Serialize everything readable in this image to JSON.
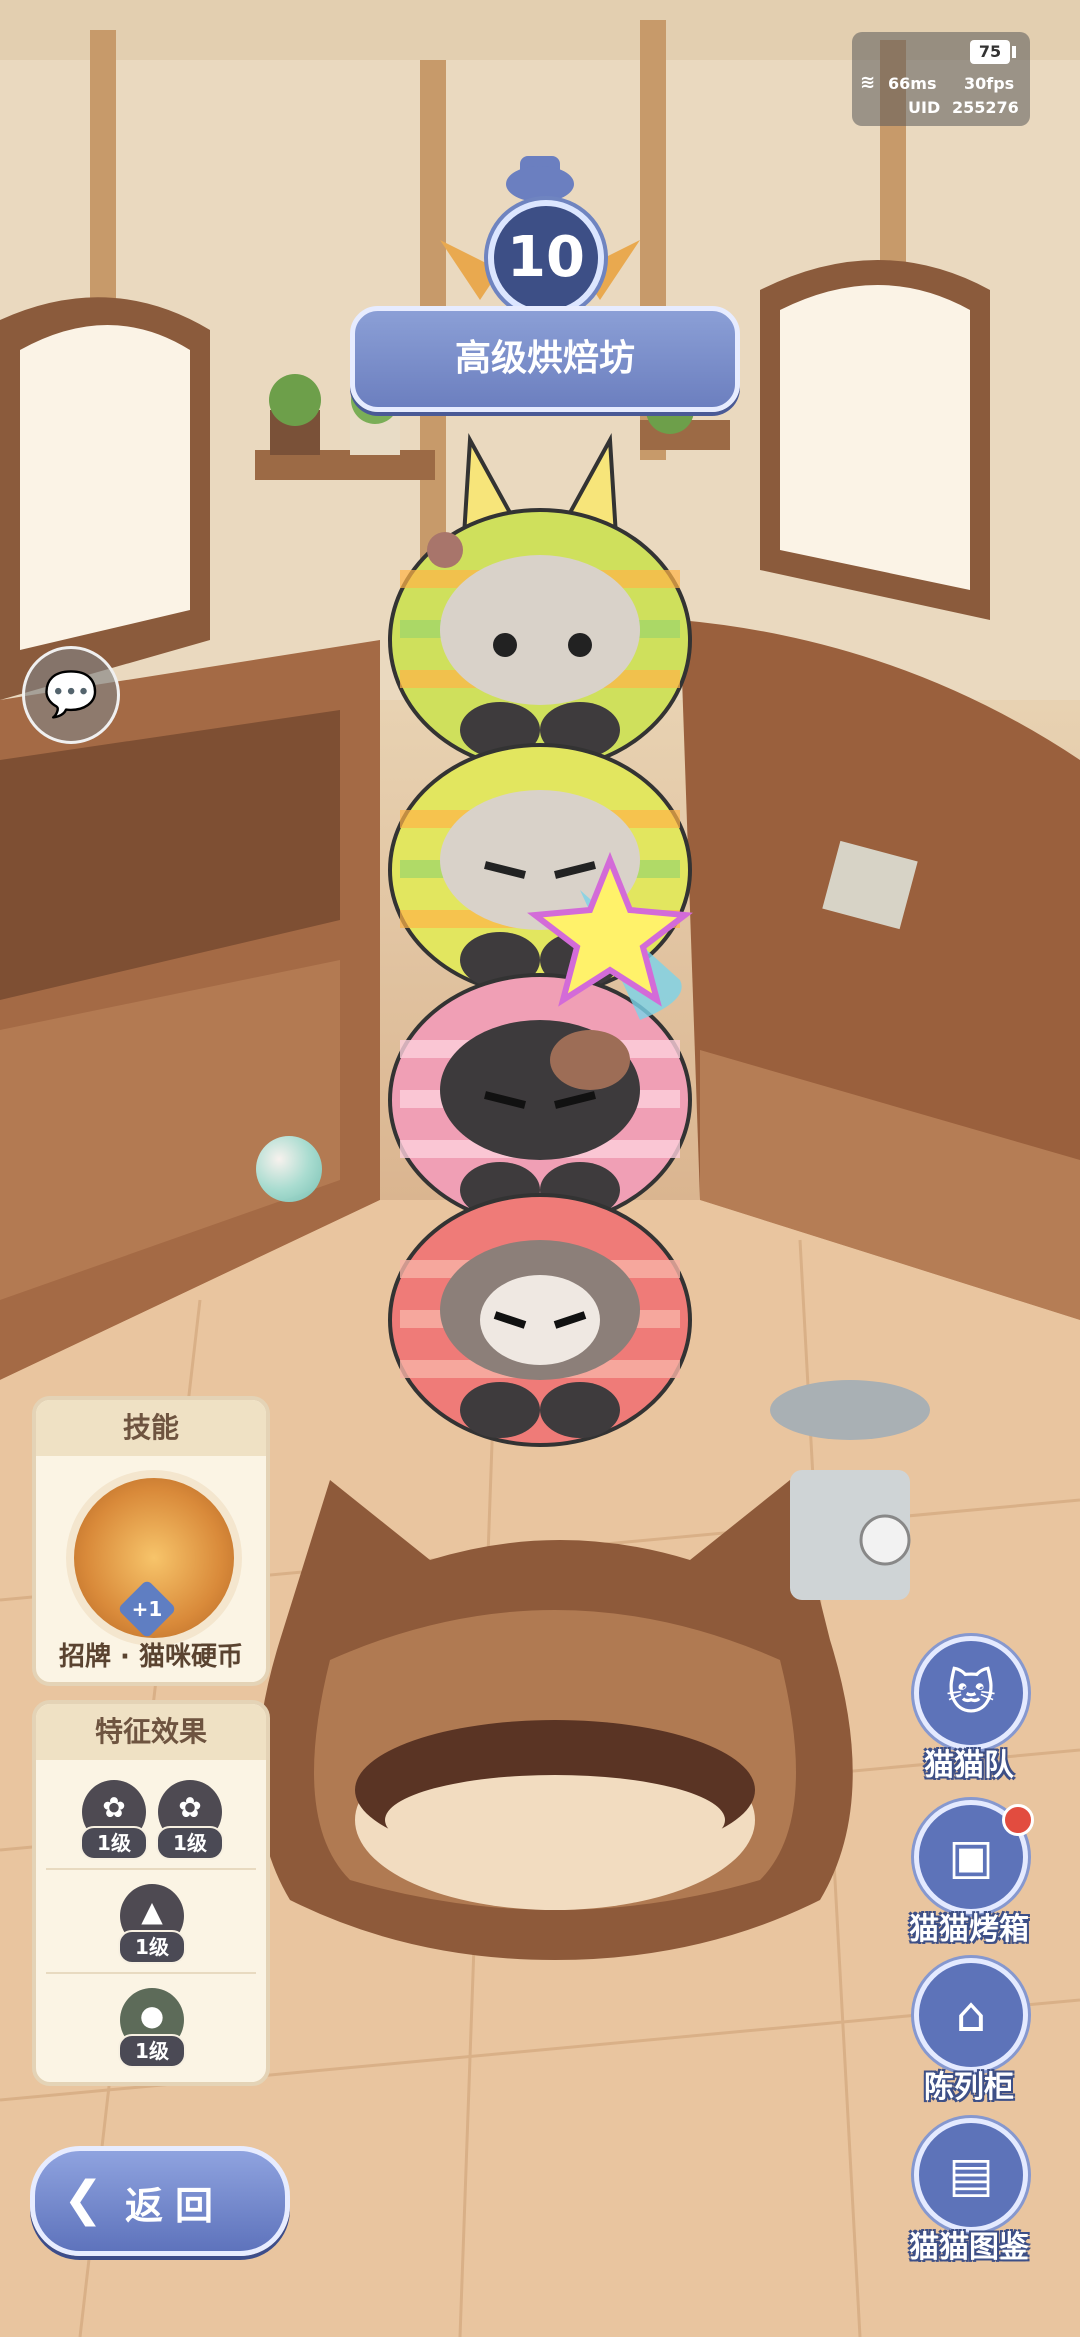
{
  "status": {
    "battery": "75",
    "ping": "66ms",
    "fps": "30fps",
    "uid_label": "UID",
    "uid": "255276"
  },
  "shop": {
    "level": "10",
    "name": "高级烘焙坊"
  },
  "skill_panel": {
    "title": "技能",
    "badge": "+1",
    "skill_name": "招牌 · 猫咪硬币"
  },
  "trait_panel": {
    "title": "特征效果",
    "rows": [
      {
        "traits": [
          {
            "icon": "flower-icon",
            "level": "1级"
          },
          {
            "icon": "flower-icon",
            "level": "1级"
          }
        ]
      },
      {
        "traits": [
          {
            "icon": "triangle-icon",
            "level": "1级"
          }
        ]
      },
      {
        "traits": [
          {
            "icon": "leaf-ball-icon",
            "level": "1级"
          }
        ]
      }
    ]
  },
  "back_button": {
    "label": "返回"
  },
  "right_menu": [
    {
      "label": "猫猫队",
      "icon": "cat-team-icon"
    },
    {
      "label": "猫猫烤箱",
      "icon": "cat-oven-icon",
      "notification": true
    },
    {
      "label": "陈列柜",
      "icon": "display-cabinet-icon"
    },
    {
      "label": "猫猫图鉴",
      "icon": "cat-encyclopedia-icon"
    }
  ],
  "cats": [
    {
      "expression": ". ᴥ ."
    },
    {
      "expression": "˃ ᴥ ˂"
    },
    {
      "expression": "˃ ω ˂"
    },
    {
      "expression": "˃ ▽ ˂"
    }
  ],
  "colors": {
    "accent_blue": "#5d73b9",
    "panel_bg": "#fbf4e4",
    "notification_red": "#e24c3f"
  }
}
